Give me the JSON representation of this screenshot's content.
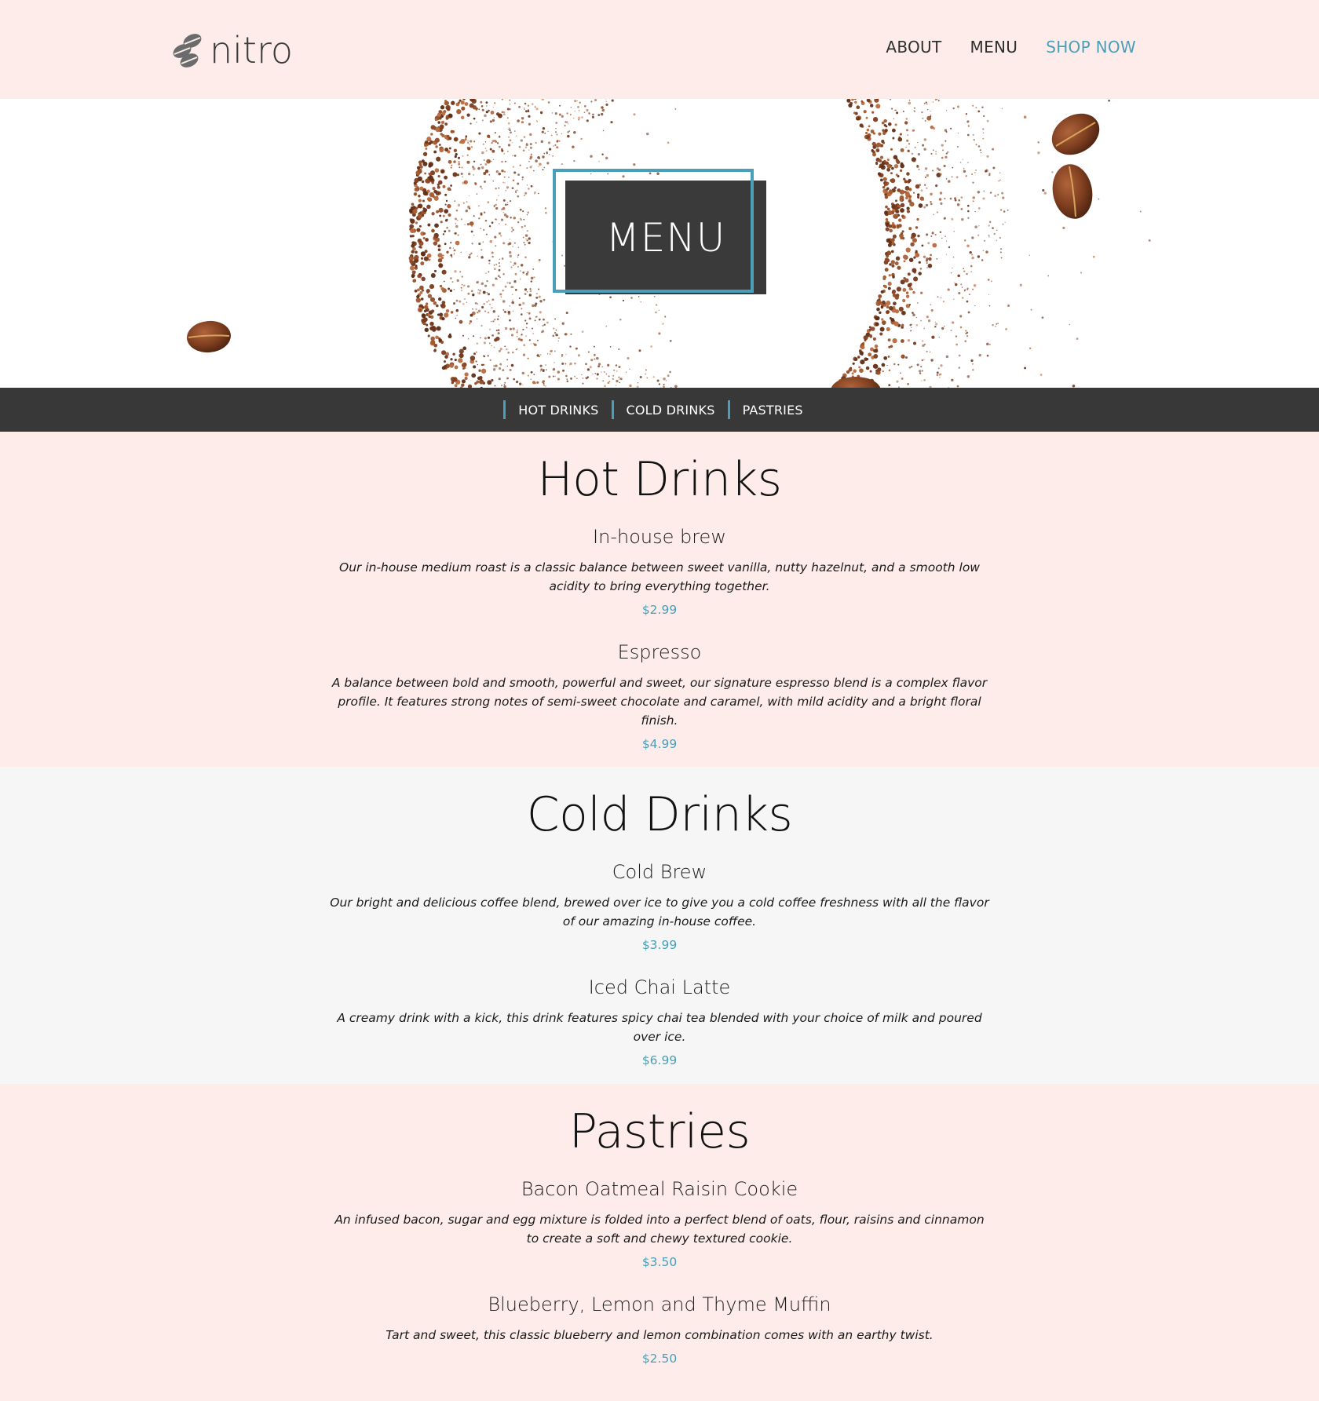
{
  "theme": {
    "accent": "#4a9fb8",
    "dark": "#383838",
    "pink": "#fdecea",
    "gray": "#f6f6f6"
  },
  "header": {
    "brand": "nitro",
    "logo_icon": "coffee-beans-icon",
    "nav": [
      {
        "label": "ABOUT"
      },
      {
        "label": "MENU"
      },
      {
        "label": "SHOP NOW",
        "accent": true
      }
    ]
  },
  "hero": {
    "title": "MENU"
  },
  "categories": [
    {
      "label": "HOT DRINKS"
    },
    {
      "label": "COLD DRINKS"
    },
    {
      "label": "PASTRIES"
    }
  ],
  "sections": [
    {
      "title": "Hot Drinks",
      "items": [
        {
          "name": "In-house brew",
          "description": "Our in-house medium roast is a classic balance between sweet vanilla, nutty hazelnut, and a smooth low acidity to bring everything together.",
          "price": "$2.99"
        },
        {
          "name": "Espresso",
          "description": "A balance between bold and smooth, powerful and sweet, our signature espresso blend is a complex flavor profile. It features strong notes of semi-sweet chocolate and caramel, with mild acidity and a bright floral finish.",
          "price": "$4.99"
        }
      ]
    },
    {
      "title": "Cold Drinks",
      "items": [
        {
          "name": "Cold Brew",
          "description": "Our bright and delicious coffee blend, brewed over ice to give you a cold coffee freshness with all the flavor of our amazing in-house coffee.",
          "price": "$3.99"
        },
        {
          "name": "Iced Chai Latte",
          "description": "A creamy drink with a kick, this drink features spicy chai tea blended with your choice of milk and poured over ice.",
          "price": "$6.99"
        }
      ]
    },
    {
      "title": "Pastries",
      "items": [
        {
          "name": "Bacon Oatmeal Raisin Cookie",
          "description": "An infused bacon, sugar and egg mixture is folded into a perfect blend of oats, flour, raisins and cinnamon to create a soft and chewy textured cookie.",
          "price": "$3.50"
        },
        {
          "name": "Blueberry, Lemon and Thyme Muffin",
          "description": "Tart and sweet, this classic blueberry and lemon combination comes with an earthy twist.",
          "price": "$2.50"
        }
      ]
    }
  ]
}
